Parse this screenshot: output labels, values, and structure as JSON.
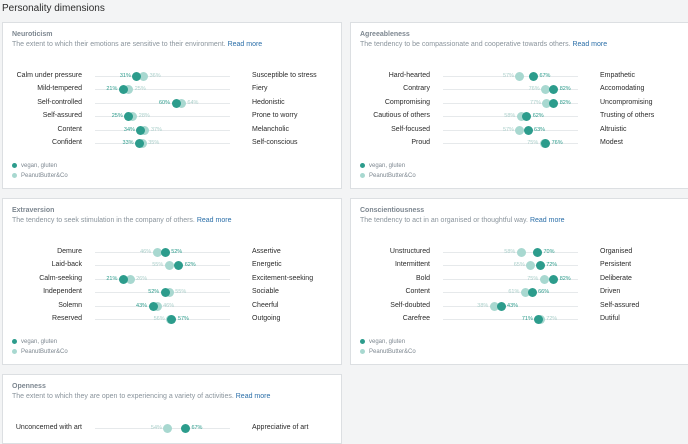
{
  "page": {
    "title": "Personality dimensions",
    "read_more": "Read more"
  },
  "legend": [
    {
      "name": "vegan, gluten",
      "color": "#2c9c8c"
    },
    {
      "name": "PeanutButter&Co",
      "color": "#a8d8d0"
    }
  ],
  "cards": [
    {
      "id": "neuroticism",
      "title": "Neuroticism",
      "description": "The extent to which their emotions are sensitive to their environment.",
      "rows": [
        {
          "left": "Calm under pressure",
          "right": "Susceptible to stress",
          "vegan": 31,
          "peanut": 36
        },
        {
          "left": "Mild-tempered",
          "right": "Fiery",
          "vegan": 21,
          "peanut": 25
        },
        {
          "left": "Self-controlled",
          "right": "Hedonistic",
          "vegan": 60,
          "peanut": 64
        },
        {
          "left": "Self-assured",
          "right": "Prone to worry",
          "vegan": 25,
          "peanut": 28
        },
        {
          "left": "Content",
          "right": "Melancholic",
          "vegan": 34,
          "peanut": 37
        },
        {
          "left": "Confident",
          "right": "Self-conscious",
          "vegan": 33,
          "peanut": 35
        }
      ]
    },
    {
      "id": "agreeableness",
      "title": "Agreeableness",
      "description": "The tendency to be compassionate and cooperative towards others.",
      "rows": [
        {
          "left": "Hard-hearted",
          "right": "Empathetic",
          "vegan": 67,
          "peanut": 57
        },
        {
          "left": "Contrary",
          "right": "Accomodating",
          "vegan": 82,
          "peanut": 76
        },
        {
          "left": "Compromising",
          "right": "Uncompromising",
          "vegan": 82,
          "peanut": 77
        },
        {
          "left": "Cautious of others",
          "right": "Trusting of others",
          "vegan": 62,
          "peanut": 58
        },
        {
          "left": "Self-focused",
          "right": "Altruistic",
          "vegan": 63,
          "peanut": 57
        },
        {
          "left": "Proud",
          "right": "Modest",
          "vegan": 76,
          "peanut": 75
        }
      ]
    },
    {
      "id": "extraversion",
      "title": "Extraversion",
      "description": "The tendency to seek stimulation in the company of others.",
      "rows": [
        {
          "left": "Demure",
          "right": "Assertive",
          "vegan": 52,
          "peanut": 46
        },
        {
          "left": "Laid-back",
          "right": "Energetic",
          "vegan": 62,
          "peanut": 55
        },
        {
          "left": "Calm-seeking",
          "right": "Excitement-seeking",
          "vegan": 21,
          "peanut": 26
        },
        {
          "left": "Independent",
          "right": "Sociable",
          "vegan": 52,
          "peanut": 55
        },
        {
          "left": "Solemn",
          "right": "Cheerful",
          "vegan": 43,
          "peanut": 46
        },
        {
          "left": "Reserved",
          "right": "Outgoing",
          "vegan": 57,
          "peanut": 56
        }
      ]
    },
    {
      "id": "conscientiousness",
      "title": "Conscientiousness",
      "description": "The tendency to act in an organised or thoughtful way.",
      "rows": [
        {
          "left": "Unstructured",
          "right": "Organised",
          "vegan": 70,
          "peanut": 58
        },
        {
          "left": "Intermittent",
          "right": "Persistent",
          "vegan": 72,
          "peanut": 65
        },
        {
          "left": "Bold",
          "right": "Deliberate",
          "vegan": 82,
          "peanut": 75
        },
        {
          "left": "Content",
          "right": "Driven",
          "vegan": 66,
          "peanut": 61
        },
        {
          "left": "Self-doubted",
          "right": "Self-assured",
          "vegan": 43,
          "peanut": 38
        },
        {
          "left": "Carefree",
          "right": "Dutiful",
          "vegan": 71,
          "peanut": 72
        }
      ]
    },
    {
      "id": "openness",
      "title": "Openness",
      "description": "The extent to which they are open to experiencing a variety of activities.",
      "rows": [
        {
          "left": "Unconcerned with art",
          "right": "Appreciative of art",
          "vegan": 67,
          "peanut": 54
        }
      ]
    }
  ]
}
